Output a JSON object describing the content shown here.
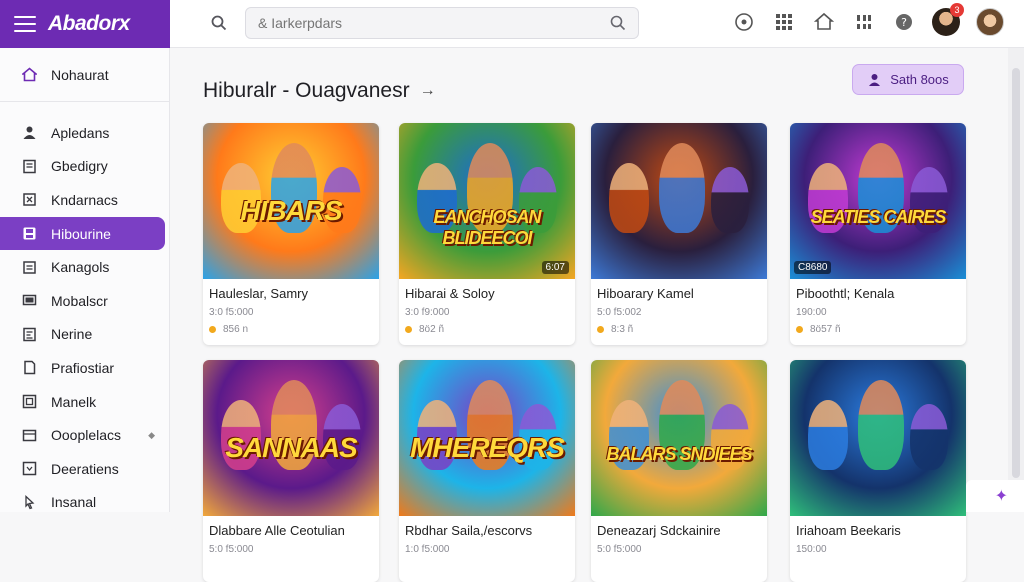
{
  "app": {
    "brand": "Abadorx"
  },
  "search": {
    "placeholder": "& Iarkerpdars"
  },
  "top_badge": "3",
  "sidebar": {
    "home": "Nohaurat",
    "items": [
      {
        "label": "Apledans",
        "icon": "person-icon"
      },
      {
        "label": "Gbedigry",
        "icon": "document-icon"
      },
      {
        "label": "Kndarnacs",
        "icon": "key-icon"
      },
      {
        "label": "Hibourine",
        "icon": "save-icon",
        "active": true
      },
      {
        "label": "Kanagols",
        "icon": "list-icon"
      },
      {
        "label": "Mobalscr",
        "icon": "monitor-icon"
      },
      {
        "label": "Nerine",
        "icon": "text-lines-icon"
      },
      {
        "label": "Prafiostiar",
        "icon": "page-icon"
      },
      {
        "label": "Manelk",
        "icon": "frame-icon"
      },
      {
        "label": "Oooplelacs",
        "icon": "box-icon",
        "expandable": true
      },
      {
        "label": "Deeratiens",
        "icon": "chevron-box-icon"
      },
      {
        "label": "Insanal",
        "icon": "cursor-icon"
      }
    ]
  },
  "main": {
    "section_title": "Hiburalr - Ouagvanesr",
    "start_button": "Sath 8oos"
  },
  "cards": [
    {
      "title": "Hauleslar, Samry",
      "meta": "3:0 f5:000",
      "rating": "856 n",
      "thumb_text": "HIBARS",
      "tag": "",
      "colors": [
        "#ff7a1a",
        "#ffcf33",
        "#2aa2e8"
      ]
    },
    {
      "title": "Hibarai & Soloy",
      "meta": "3:0 f9:000",
      "rating": "8ö2 ñ",
      "thumb_text": "EANCHOSAN BLIDEECOI",
      "tag": "6:07",
      "colors": [
        "#3b9c3a",
        "#1d6bd1",
        "#f5a623"
      ]
    },
    {
      "title": "Hiboarary Kamel",
      "meta": "5:0 f5:002",
      "rating": "8:3 ñ",
      "thumb_text": "",
      "tag": "",
      "colors": [
        "#2a1f3d",
        "#c24a12",
        "#3d7ad6"
      ]
    },
    {
      "title": "Piboothtl; Kenala",
      "meta": "190:00",
      "rating": "8ö57 ñ",
      "thumb_text": "SEATIES CAIRES",
      "tag": "C8680",
      "colors": [
        "#3d1f78",
        "#c23bd4",
        "#1a8fd6"
      ]
    },
    {
      "title": "Dlabbare Alle Ceotulian",
      "meta": "5:0 f5:000",
      "rating": "",
      "thumb_text": "SANNAAS",
      "tag": "",
      "colors": [
        "#5b1a8a",
        "#d63f8c",
        "#f2a93b"
      ]
    },
    {
      "title": "Rbdhar Saila,/escorvs",
      "meta": "1:0 f5:000",
      "rating": "",
      "thumb_text": "MHEREQRS",
      "tag": "",
      "colors": [
        "#1db4e8",
        "#7b3fc4",
        "#f07a1a"
      ]
    },
    {
      "title": "Deneazarj Sdckainire",
      "meta": "5:0 f5:000",
      "rating": "",
      "thumb_text": "BALARS SNDIEES",
      "tag": "",
      "colors": [
        "#f2a93b",
        "#3d8fd6",
        "#2fa84a"
      ]
    },
    {
      "title": "Iriahoam Beekaris",
      "meta": "150:00",
      "rating": "",
      "thumb_text": "",
      "tag": "",
      "colors": [
        "#14336b",
        "#2b7ce0",
        "#2fbf7a"
      ]
    }
  ]
}
